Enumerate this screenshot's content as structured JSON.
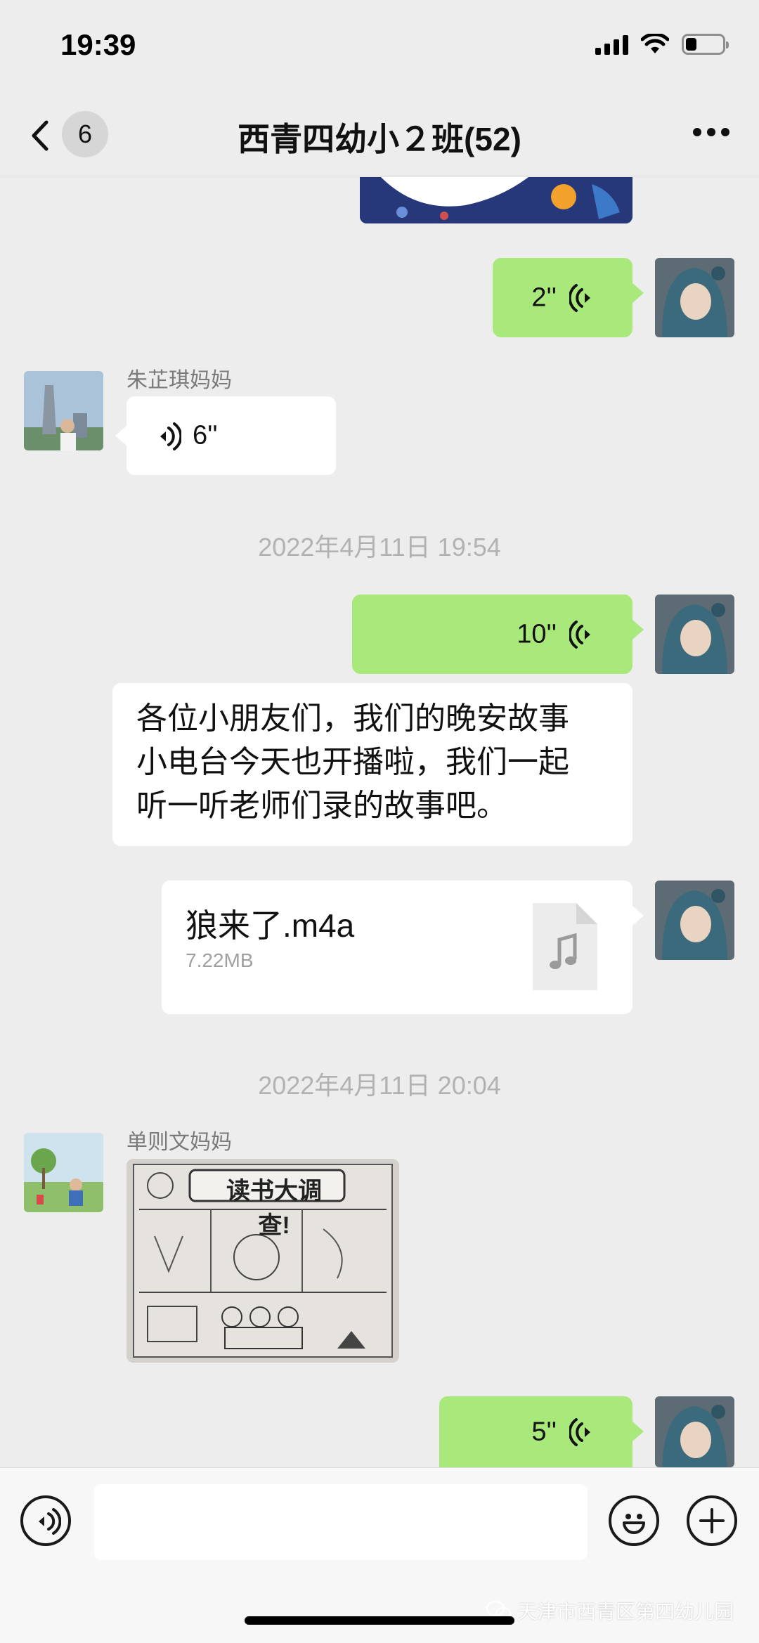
{
  "status_bar": {
    "time": "19:39",
    "battery_level": 0.3
  },
  "header": {
    "back_badge": "6",
    "title": "西青四幼小２班(52)"
  },
  "messages": {
    "voice_out_1": {
      "duration": "2''"
    },
    "voice_in_1": {
      "sender": "朱芷琪妈妈",
      "duration": "6''"
    },
    "timestamp_1": "2022年4月11日 19:54",
    "voice_out_2": {
      "duration": "10''"
    },
    "text_1": {
      "lines": [
        "各位小朋友们，我们的晚安故事",
        "小电台今天也开播啦，我们一起",
        "听一听老师们录的故事吧。"
      ]
    },
    "file_1": {
      "name": "狼来了.m4a",
      "size": "7.22MB"
    },
    "timestamp_2": "2022年4月11日 20:04",
    "image_in_1": {
      "sender": "单则文妈妈",
      "image_title": "读书大调查!"
    },
    "voice_out_3": {
      "duration": "5''"
    }
  },
  "watermark": "天津市西青区第四幼儿园",
  "colors": {
    "outgoing_bubble": "#a9e97b",
    "incoming_bubble": "#ffffff",
    "background": "#ededed"
  }
}
